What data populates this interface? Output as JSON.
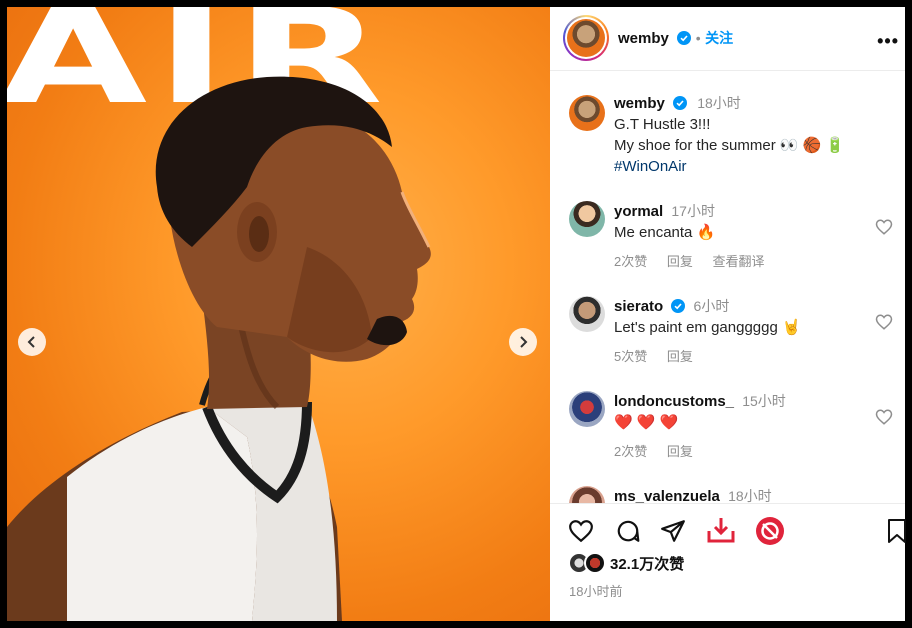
{
  "post": {
    "username": "wemby",
    "follow_label": "关注",
    "dot": "•",
    "more": "•••",
    "image_headline": "AIR"
  },
  "caption": {
    "username": "wemby",
    "time": "18小时",
    "lines": [
      "G.T Hustle 3!!!",
      "My shoe for the summer 👀 🏀 🔋"
    ],
    "hashtag": "#WinOnAir"
  },
  "comments": [
    {
      "username": "yormal",
      "time": "17小时",
      "text": "Me encanta 🔥",
      "likes": "2次赞",
      "reply": "回复",
      "translate": "查看翻译",
      "verified": false
    },
    {
      "username": "sierato",
      "time": "6小时",
      "text": "Let's paint em ganggggg 🤘",
      "likes": "5次赞",
      "reply": "回复",
      "verified": true
    },
    {
      "username": "londoncustoms_",
      "time": "15小时",
      "text": "❤️ ❤️ ❤️",
      "likes": "2次赞",
      "reply": "回复",
      "verified": false
    },
    {
      "username": "ms_valenzuela",
      "time": "18小时",
      "verified": false
    }
  ],
  "footer": {
    "likes": "32.1万次赞",
    "posted": "18小时前"
  },
  "colors": {
    "accent": "#0095f6",
    "verified": "#0095f6",
    "download": "#e0243b",
    "image_orange": "#f27d14"
  },
  "icons": [
    "heart-icon",
    "comment-icon",
    "share-icon",
    "download-icon",
    "refresh-icon",
    "bookmark-icon",
    "chevron-left-icon",
    "chevron-right-icon",
    "verified-badge-icon"
  ]
}
